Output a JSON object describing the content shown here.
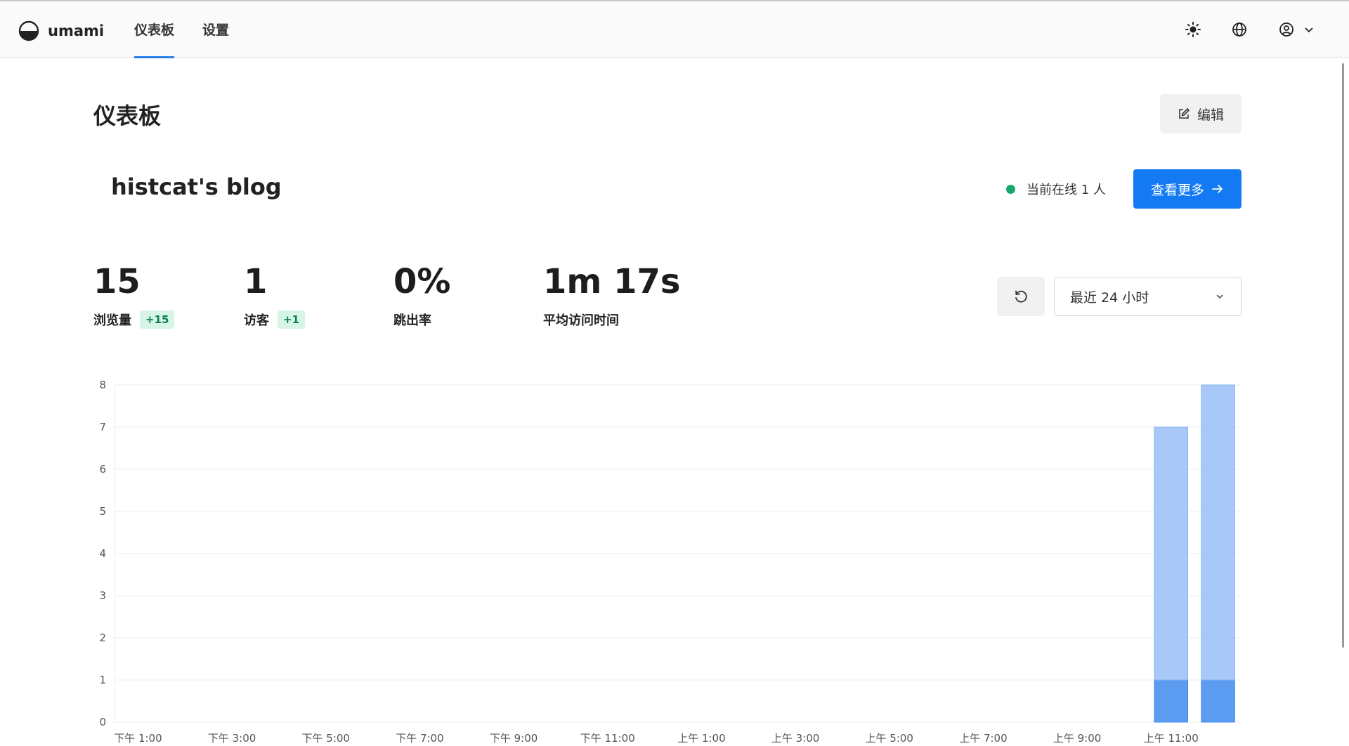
{
  "app": {
    "logo_text": "umami"
  },
  "nav": [
    {
      "label": "仪表板",
      "active": true
    },
    {
      "label": "设置",
      "active": false
    }
  ],
  "icons": {
    "theme": "sun-icon",
    "language": "globe-icon",
    "profile": "user-circle-icon",
    "profile_menu": "chevron-down-icon"
  },
  "page": {
    "title": "仪表板",
    "edit_label": "编辑"
  },
  "site": {
    "name": "histcat's blog",
    "online_text": "当前在线 1 人",
    "view_more_label": "查看更多"
  },
  "metrics": [
    {
      "value": "15",
      "label": "浏览量",
      "change": "+15"
    },
    {
      "value": "1",
      "label": "访客",
      "change": "+1"
    },
    {
      "value": "0%",
      "label": "跳出率",
      "change": ""
    },
    {
      "value": "1m 17s",
      "label": "平均访问时间",
      "change": ""
    }
  ],
  "date_range": {
    "selected": "最近 24 小时"
  },
  "colors": {
    "accent": "#147af3",
    "online": "#15a96b",
    "bar_light": "#a8c9f7",
    "bar_dark": "#5b9cf0"
  },
  "chart_data": {
    "type": "bar",
    "stacked": true,
    "ylim": [
      0,
      8
    ],
    "yticks": [
      0,
      1,
      2,
      3,
      4,
      5,
      6,
      7,
      8
    ],
    "x_tick_labels": [
      "下午 1:00",
      "下午 3:00",
      "下午 5:00",
      "下午 7:00",
      "下午 9:00",
      "下午 11:00",
      "上午 1:00",
      "上午 3:00",
      "上午 5:00",
      "上午 7:00",
      "上午 9:00",
      "上午 11:00"
    ],
    "slots": 24,
    "series": [
      {
        "values": [
          0,
          0,
          0,
          0,
          0,
          0,
          0,
          0,
          0,
          0,
          0,
          0,
          0,
          0,
          0,
          0,
          0,
          0,
          0,
          0,
          0,
          0,
          1,
          1
        ]
      },
      {
        "values": [
          0,
          0,
          0,
          0,
          0,
          0,
          0,
          0,
          0,
          0,
          0,
          0,
          0,
          0,
          0,
          0,
          0,
          0,
          0,
          0,
          0,
          0,
          6,
          7
        ]
      }
    ]
  }
}
